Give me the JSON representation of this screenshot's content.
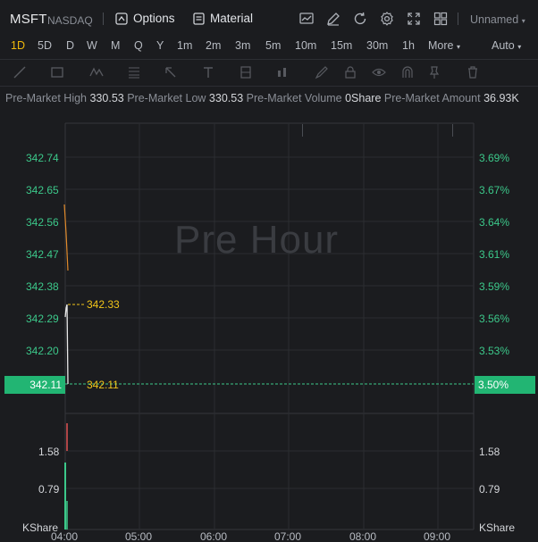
{
  "header": {
    "symbol": "MSFT",
    "exchange": "NASDAQ",
    "options_label": "Options",
    "material_label": "Material",
    "layout_name": "Unnamed",
    "icons": [
      "chart-icon",
      "draw-icon",
      "refresh-icon",
      "settings-icon",
      "fullscreen-icon",
      "grid-icon"
    ]
  },
  "timeframes": {
    "items": [
      "1D",
      "5D",
      "D",
      "W",
      "M",
      "Q",
      "Y",
      "1m",
      "2m",
      "3m",
      "5m",
      "10m",
      "15m",
      "30m",
      "1h"
    ],
    "active": "1D",
    "more_label": "More",
    "scale_label": "Auto"
  },
  "info": {
    "pm_high_label": "Pre-Market High",
    "pm_high_value": "330.53",
    "pm_low_label": "Pre-Market Low",
    "pm_low_value": "330.53",
    "pm_volume_label": "Pre-Market Volume",
    "pm_volume_value": "0Share",
    "pm_amount_label": "Pre-Market Amount",
    "pm_amount_value": "36.93K"
  },
  "chart": {
    "watermark": "Pre Hour",
    "price_axis_left": [
      "342.74",
      "342.65",
      "342.56",
      "342.47",
      "342.38",
      "342.29",
      "342.20"
    ],
    "pct_axis_right": [
      "3.69%",
      "3.67%",
      "3.64%",
      "3.61%",
      "3.59%",
      "3.56%",
      "3.53%"
    ],
    "current_price": "342.11",
    "current_pct": "3.50%",
    "annot_high": "342.33",
    "annot_current": "342.11",
    "volume_axis_left": [
      "1.58",
      "0.79"
    ],
    "volume_axis_right": [
      "1.58",
      "0.79"
    ],
    "volume_unit_left": "KShare",
    "volume_unit_right": "KShare",
    "time_labels": [
      "04:00",
      "05:00",
      "06:00",
      "07:00",
      "08:00",
      "09:00"
    ],
    "colors": {
      "up": "#3cc88a",
      "down": "#e05252",
      "accent": "#f0b90b",
      "line": "#e8e8e8"
    }
  },
  "chart_data": {
    "type": "line",
    "title": "",
    "xlabel": "",
    "ylabel": "",
    "x": [
      "04:00",
      "04:01"
    ],
    "series": [
      {
        "values": [
          342.33,
          342.11
        ]
      }
    ],
    "ylim": [
      342.11,
      342.78
    ],
    "pct_range": [
      "3.50%",
      "3.69%"
    ],
    "volume_ylim": [
      0,
      1.9
    ],
    "grid": true
  }
}
